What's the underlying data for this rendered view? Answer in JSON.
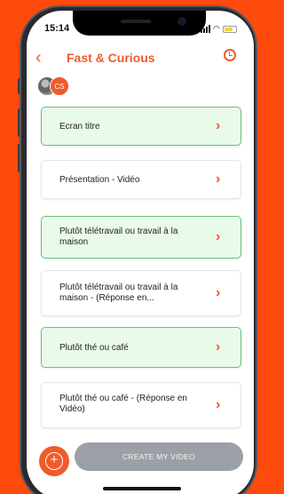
{
  "status": {
    "time": "15:14"
  },
  "header": {
    "back_icon": "chevron-left-icon",
    "title": "Fast & Curious",
    "history_icon": "history-clock-icon"
  },
  "participants": {
    "initials": "CS"
  },
  "items": [
    {
      "label": "Ecran titre",
      "highlighted": true
    },
    {
      "label": "Présentation - Vidéo",
      "highlighted": false
    },
    {
      "label": "Plutôt télétravail ou travail à la maison",
      "highlighted": true
    },
    {
      "label": "Plutôt télétravail ou travail à la maison - (Réponse en...",
      "highlighted": false
    },
    {
      "label": "Plutôt thé ou café",
      "highlighted": true
    },
    {
      "label": "Plutôt thé ou café - (Réponse en Vidéo)",
      "highlighted": false
    }
  ],
  "footer": {
    "add_icon": "plus-circle-icon",
    "create_label": "CREATE MY VIDEO"
  },
  "colors": {
    "accent": "#f15a2b",
    "highlight_bg": "#eafaea",
    "highlight_border": "#66c27a",
    "background": "#fe4a0d",
    "disabled_button": "#9aa0a6"
  }
}
